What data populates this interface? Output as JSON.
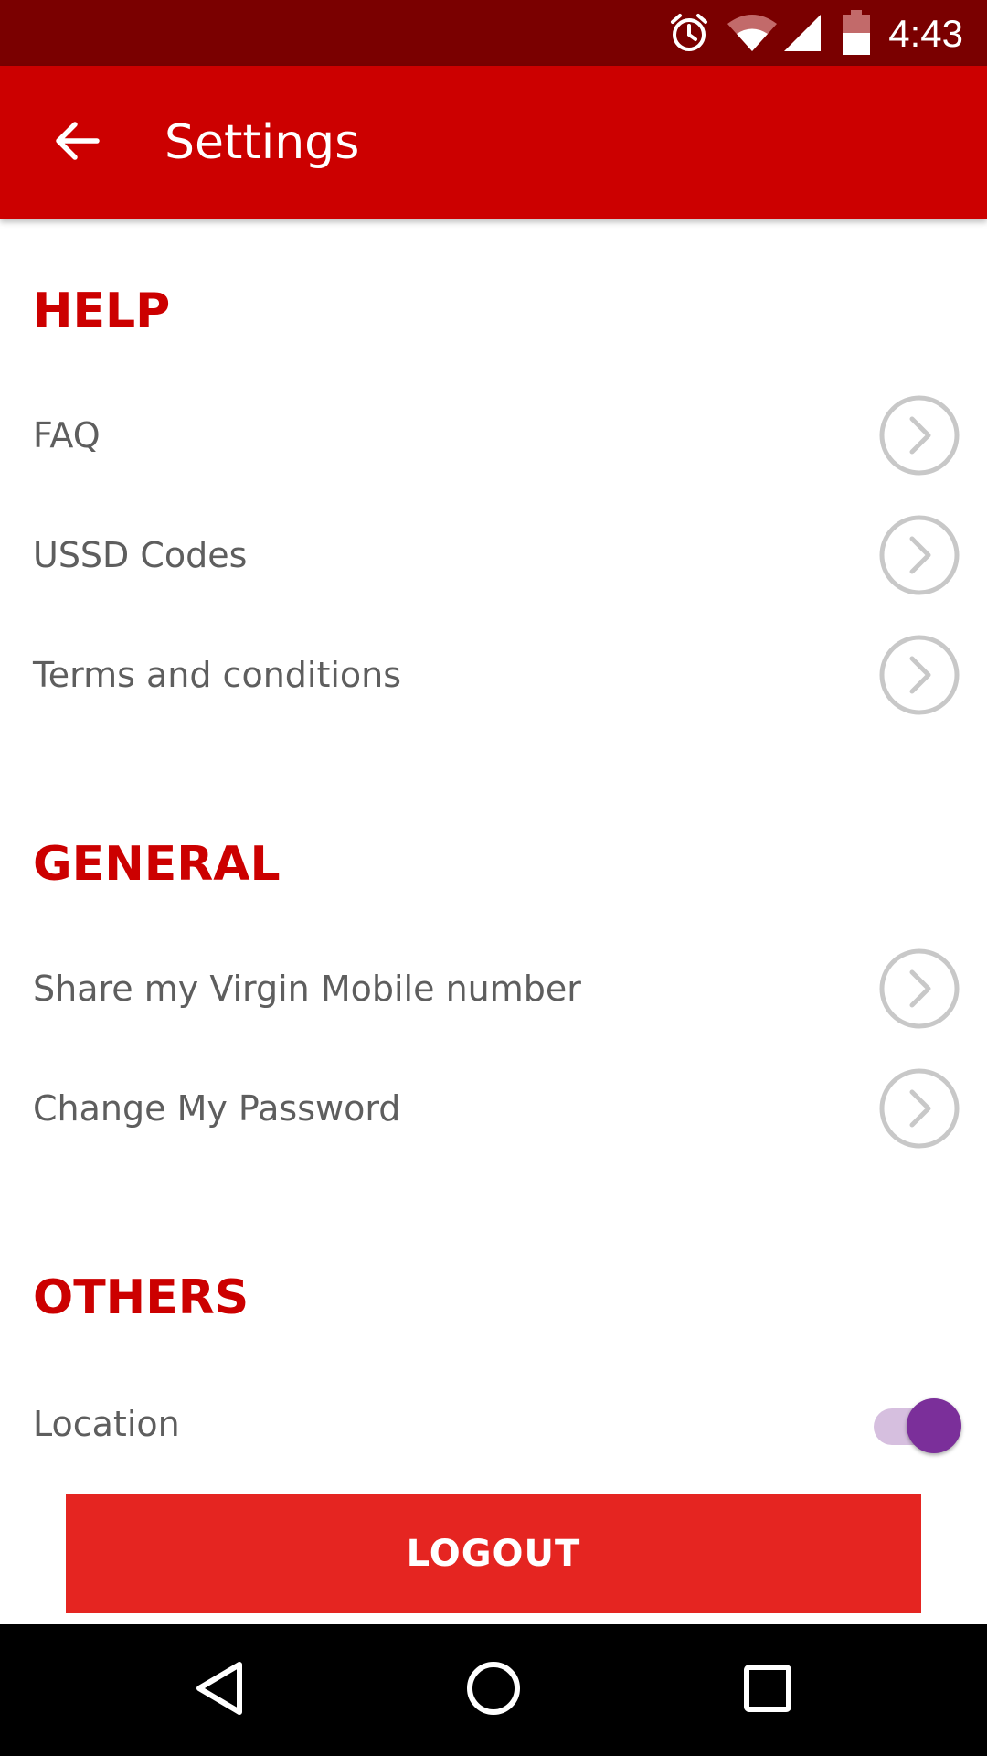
{
  "status_bar": {
    "time": "4:43",
    "icons": [
      "alarm-icon",
      "wifi-icon",
      "cell-signal-icon",
      "battery-icon"
    ]
  },
  "app_bar": {
    "title": "Settings",
    "back_icon": "arrow-left-icon"
  },
  "sections": {
    "help": {
      "title": "HELP",
      "items": [
        {
          "label": "FAQ"
        },
        {
          "label": "USSD Codes"
        },
        {
          "label": "Terms and conditions"
        }
      ]
    },
    "general": {
      "title": "GENERAL",
      "items": [
        {
          "label": "Share my Virgin Mobile number"
        },
        {
          "label": "Change My Password"
        }
      ]
    },
    "others": {
      "title": "OTHERS",
      "items": [
        {
          "label": "Location",
          "toggle_on": true
        }
      ]
    }
  },
  "logout": {
    "label": "LOGOUT"
  },
  "nav_bar": {
    "icons": [
      "back-triangle-icon",
      "home-circle-icon",
      "recents-square-icon"
    ]
  },
  "colors": {
    "status_bar": "#7a0000",
    "app_bar": "#cc0000",
    "section_header": "#cc0000",
    "logout_button": "#e52521",
    "toggle_thumb": "#7b2f9a",
    "toggle_track": "#d6bfdf",
    "chevron_gray": "#c8c8c8"
  }
}
